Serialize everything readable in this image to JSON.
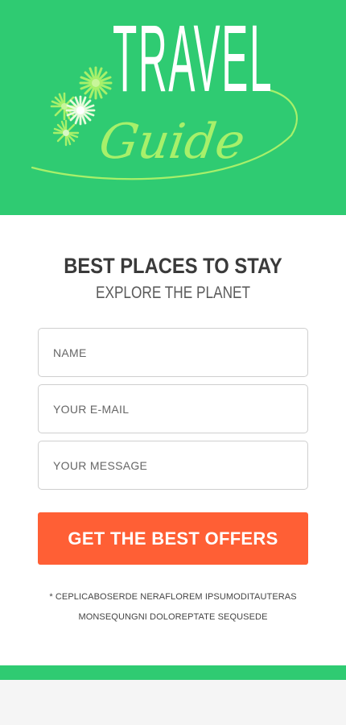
{
  "header": {
    "logo_title": "TRAVEL",
    "logo_subtitle": "Guide",
    "background_color": "#2fcb72",
    "flower_colors": [
      "#a7f06a",
      "#d8f7c4",
      "#ffffff"
    ]
  },
  "main": {
    "heading": "BEST PLACES TO STAY",
    "subheading": "EXPLORE THE PLANET",
    "form": {
      "name_placeholder": "NAME",
      "email_placeholder": "YOUR E-MAIL",
      "message_placeholder": "YOUR MESSAGE",
      "submit_label": "GET THE BEST OFFERS"
    },
    "disclaimer": "* CEPLICABOSERDE NERAFLOREM IPSUMODITAUTERAS MONSEQUNGNI DOLOREPTATE SEQUSEDE"
  },
  "colors": {
    "accent_green": "#2fcb72",
    "cta_orange": "#ff5f35",
    "subtitle_lime": "#a7f06a"
  }
}
